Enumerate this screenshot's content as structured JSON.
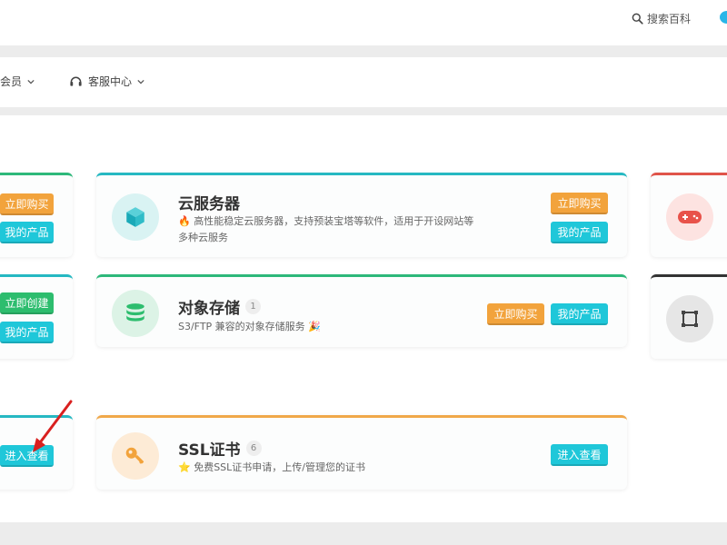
{
  "header": {
    "search_label": "搜索百科"
  },
  "nav": {
    "item1_label": "会员",
    "item2_label": "客服中心"
  },
  "cards": {
    "left_top": {
      "btn1": "立即购买",
      "btn2": "我的产品"
    },
    "left_mid": {
      "btn1": "立即创建",
      "btn2": "我的产品"
    },
    "left_bot": {
      "btn1": "进入查看"
    },
    "cloud_server": {
      "title": "云服务器",
      "desc_line1": "🔥 高性能稳定云服务器，支持预装宝塔等软件，适用于开设网站等",
      "desc_line2": "多种云服务",
      "btn_buy": "立即购买",
      "btn_products": "我的产品"
    },
    "object_storage": {
      "title": "对象存储",
      "count": "1",
      "desc": "S3/FTP 兼容的对象存储服务 🎉",
      "btn_buy": "立即购买",
      "btn_products": "我的产品"
    },
    "ssl": {
      "title": "SSL证书",
      "count": "6",
      "desc": "⭐ 免费SSL证书申请，上传/管理您的证书",
      "btn_view": "进入查看"
    }
  },
  "colors": {
    "accent_cyan": "#1fc7d9",
    "accent_orange": "#f2a33c",
    "accent_green": "#2dbd6e",
    "cloud_border": "#25b8c2",
    "storage_border": "#2db87a",
    "ssl_border": "#f0a84a",
    "game_border": "#e0544a",
    "dark_border": "#333333"
  },
  "icons": {
    "search": "search-icon",
    "headset": "headset-icon",
    "cube": "cube-icon",
    "database": "database-icon",
    "key": "key-icon",
    "gamepad": "gamepad-icon",
    "crop": "crop-square-icon"
  }
}
